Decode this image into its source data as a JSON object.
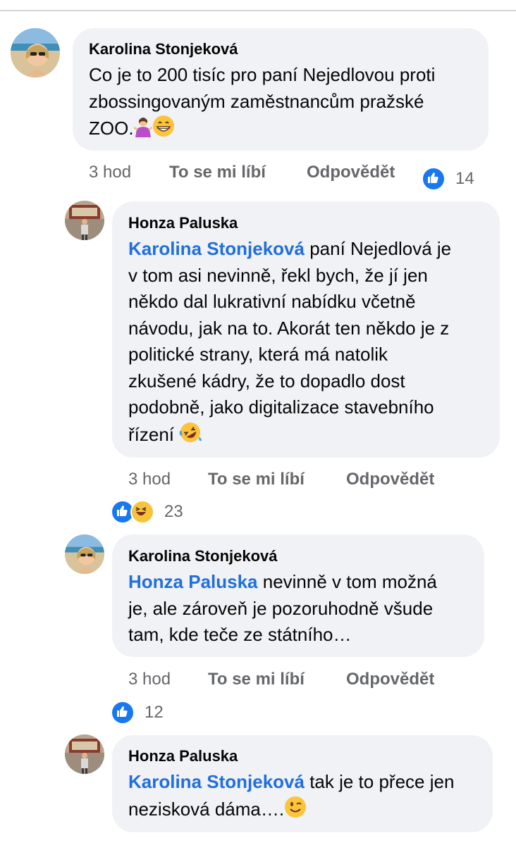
{
  "comments": [
    {
      "author": "Karolina Stonjeková",
      "mention": "",
      "lines": [
        "Co je to 200 tisíc pro paní Nejedlovou proti",
        "zbossingovaným zaměstnancům pražské",
        "ZOO."
      ],
      "time": "3 hod",
      "like_label": "To se mi líbí",
      "reply_label": "Odpovědět",
      "reaction_count": "14",
      "reaction_icons": [
        "like-icon"
      ]
    },
    {
      "author": "Honza Paluska",
      "mention": "Karolina Stonjeková",
      "lines": [
        " paní Nejedlová je",
        "v tom asi nevinně, řekl bych, že jí jen",
        "někdo dal lukrativní nabídku včetně",
        "návodu, jak na to. Akorát ten někdo je z",
        "politické strany, která má natolik",
        "zkušené kádry, že to dopadlo dost",
        "podobně, jako digitalizace stavebního",
        "řízení "
      ],
      "time": "3 hod",
      "like_label": "To se mi líbí",
      "reply_label": "Odpovědět",
      "reaction_count": "23",
      "reaction_icons": [
        "like-icon",
        "haha-icon"
      ]
    },
    {
      "author": "Karolina Stonjeková",
      "mention": "Honza Paluska",
      "lines": [
        " nevinně v tom možná",
        "je, ale zároveň je pozoruhodně všude",
        "tam, kde teče ze státního…"
      ],
      "time": "3 hod",
      "like_label": "To se mi líbí",
      "reply_label": "Odpovědět",
      "reaction_count": "12",
      "reaction_icons": [
        "like-icon"
      ]
    },
    {
      "author": "Honza Paluska",
      "mention": "Karolina Stonjeková",
      "lines": [
        " tak je to přece jen",
        "nezisková dáma…."
      ],
      "time": "",
      "like_label": "",
      "reply_label": "",
      "reaction_count": "",
      "reaction_icons": []
    }
  ]
}
